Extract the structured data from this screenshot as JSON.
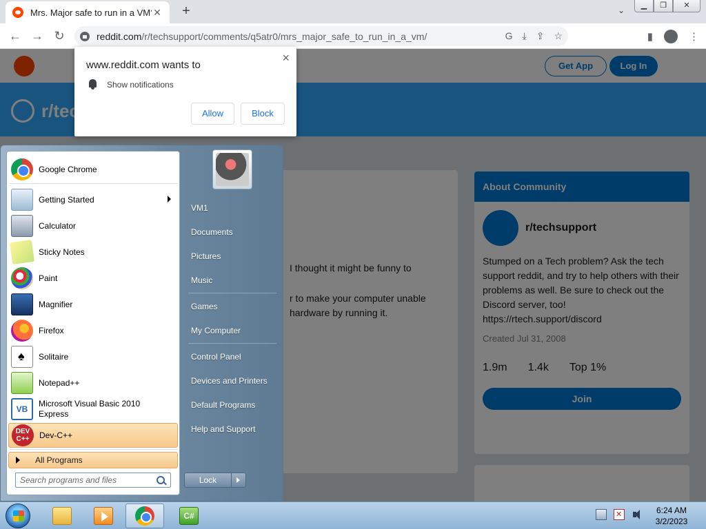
{
  "browser": {
    "tab": {
      "title": "Mrs. Major safe to run in a VM?",
      "close": "✕"
    },
    "new_tab": "+",
    "tab_search": "⌄",
    "window_buttons": {
      "minimize": "▁",
      "restore": "❐",
      "close": "✕"
    },
    "nav": {
      "back": "←",
      "forward": "→",
      "reload": "↻"
    },
    "url": {
      "host": "reddit.com",
      "path": "/r/techsupport/comments/q5atr0/mrs_major_safe_to_run_in_a_vm/"
    },
    "omni_icons": [
      "G",
      "⤓",
      "⇪",
      "☆"
    ],
    "toolbar_icons": [
      "▮",
      "⋮"
    ]
  },
  "permission_popup": {
    "title": "www.reddit.com wants to",
    "body": "Show notifications",
    "close": "×",
    "allow": "Allow",
    "block": "Block"
  },
  "reddit": {
    "header": {
      "get_app": "Get App",
      "log_in": "Log In"
    },
    "banner_title": "r/tech",
    "post_lines": [
      "I thought it might be funny to",
      "r to make your computer unable",
      "hardware by running it."
    ],
    "sidebar": {
      "header": "About Community",
      "community": "r/techsupport",
      "description": "Stumped on a Tech problem? Ask the tech support reddit, and try to help others with their problems as well. Be sure to check out the Discord server, too! https://rtech.support/discord",
      "created": "Created Jul 31, 2008",
      "stats": [
        "1.9m",
        "1.4k",
        "Top 1%"
      ],
      "join": "Join"
    }
  },
  "start_menu": {
    "programs": [
      {
        "label": "Google Chrome",
        "icon": "chrome-icon"
      },
      {
        "label": "Getting Started",
        "icon": "getting-started-icon",
        "submenu": true
      },
      {
        "label": "Calculator",
        "icon": "calculator-icon"
      },
      {
        "label": "Sticky Notes",
        "icon": "sticky-notes-icon"
      },
      {
        "label": "Paint",
        "icon": "paint-icon"
      },
      {
        "label": "Magnifier",
        "icon": "magnifier-icon"
      },
      {
        "label": "Firefox",
        "icon": "firefox-icon"
      },
      {
        "label": "Solitaire",
        "icon": "solitaire-icon"
      },
      {
        "label": "Notepad++",
        "icon": "notepadpp-icon"
      },
      {
        "label": "Microsoft Visual Basic 2010 Express",
        "label_line1": "Microsoft Visual Basic 2010",
        "label_line2": "Express",
        "icon": "visual-basic-icon"
      },
      {
        "label": "Dev-C++",
        "icon": "devcpp-icon"
      }
    ],
    "vb_icon_text": "VB",
    "dev_icon_text": "DEV C++",
    "all_programs": "All Programs",
    "search_placeholder": "Search programs and files",
    "right_items": [
      "VM1",
      "Documents",
      "Pictures",
      "Music",
      "Games",
      "My Computer",
      "Control Panel",
      "Devices and Printers",
      "Default Programs",
      "Help and Support"
    ],
    "lock": "Lock"
  },
  "taskbar": {
    "apps": [
      "windows-explorer-icon",
      "media-player-icon",
      "chrome-icon",
      "csharp-icon"
    ],
    "csharp_text": "C#",
    "clock": {
      "time": "6:24 AM",
      "date": "3/2/2023"
    }
  }
}
